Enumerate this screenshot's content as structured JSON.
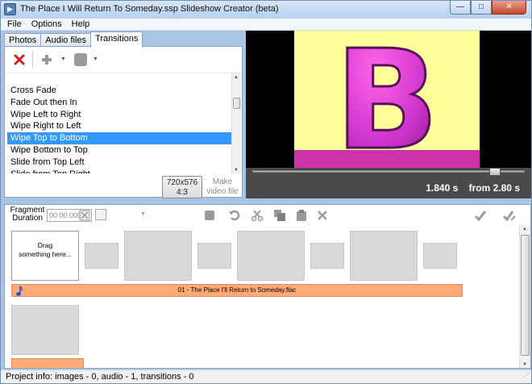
{
  "window": {
    "app_icon": "slideshow-app-icon",
    "title": "The Place I  Will Return To Someday.ssp  Slideshow Creator  (beta)",
    "controls": {
      "minimize": "—",
      "maximize": "□",
      "close": "✕"
    }
  },
  "menu": [
    "File",
    "Options",
    "Help"
  ],
  "tabs": [
    {
      "label": "Photos",
      "active": false
    },
    {
      "label": "Audio files",
      "active": false
    },
    {
      "label": "Transitions",
      "active": true
    }
  ],
  "toolbar": {
    "icons": [
      "delete-icon",
      "add-icon",
      "chevron-down-icon",
      "square-icon",
      "chevron-down-icon"
    ],
    "dropdown_glyph": "▼"
  },
  "transitions": [
    "Cross Fade",
    "Fade Out then In",
    "Wipe Left to Right",
    "Wipe Right to Left",
    "Wipe Top to Bottom",
    "Wipe Bottom to Top",
    "Slide from Top Left",
    "Slide from Top Right"
  ],
  "selected_transition_index": 4,
  "format_button": {
    "line1": "720x576",
    "line2": "4:3"
  },
  "make_button": {
    "line1": "Make",
    "line2": "video file"
  },
  "preview": {
    "letter": "B",
    "colors": {
      "slide_bg": "#ffff99",
      "letter": "#cc33aa",
      "bar": "#cc33aa"
    },
    "time": "1.840 s",
    "from": "from 2.80 s",
    "slider_fraction": 0.89
  },
  "fragment": {
    "label_line1": "Fragment",
    "label_line2": "Duration",
    "value": "00:00.000"
  },
  "timeline_toolbar_icons": [
    "stop-icon",
    "undo-icon",
    "cut-icon",
    "copy-icon",
    "paste-icon",
    "clear-icon",
    "check-icon",
    "check-edit-icon"
  ],
  "timeline": {
    "drag_text_line1": "Drag",
    "drag_text_line2": "something here...",
    "audio_track": "01 - The Place I'll Return to Someday.flac"
  },
  "status": "Project info: images - 0, audio - 1, transitions - 0"
}
